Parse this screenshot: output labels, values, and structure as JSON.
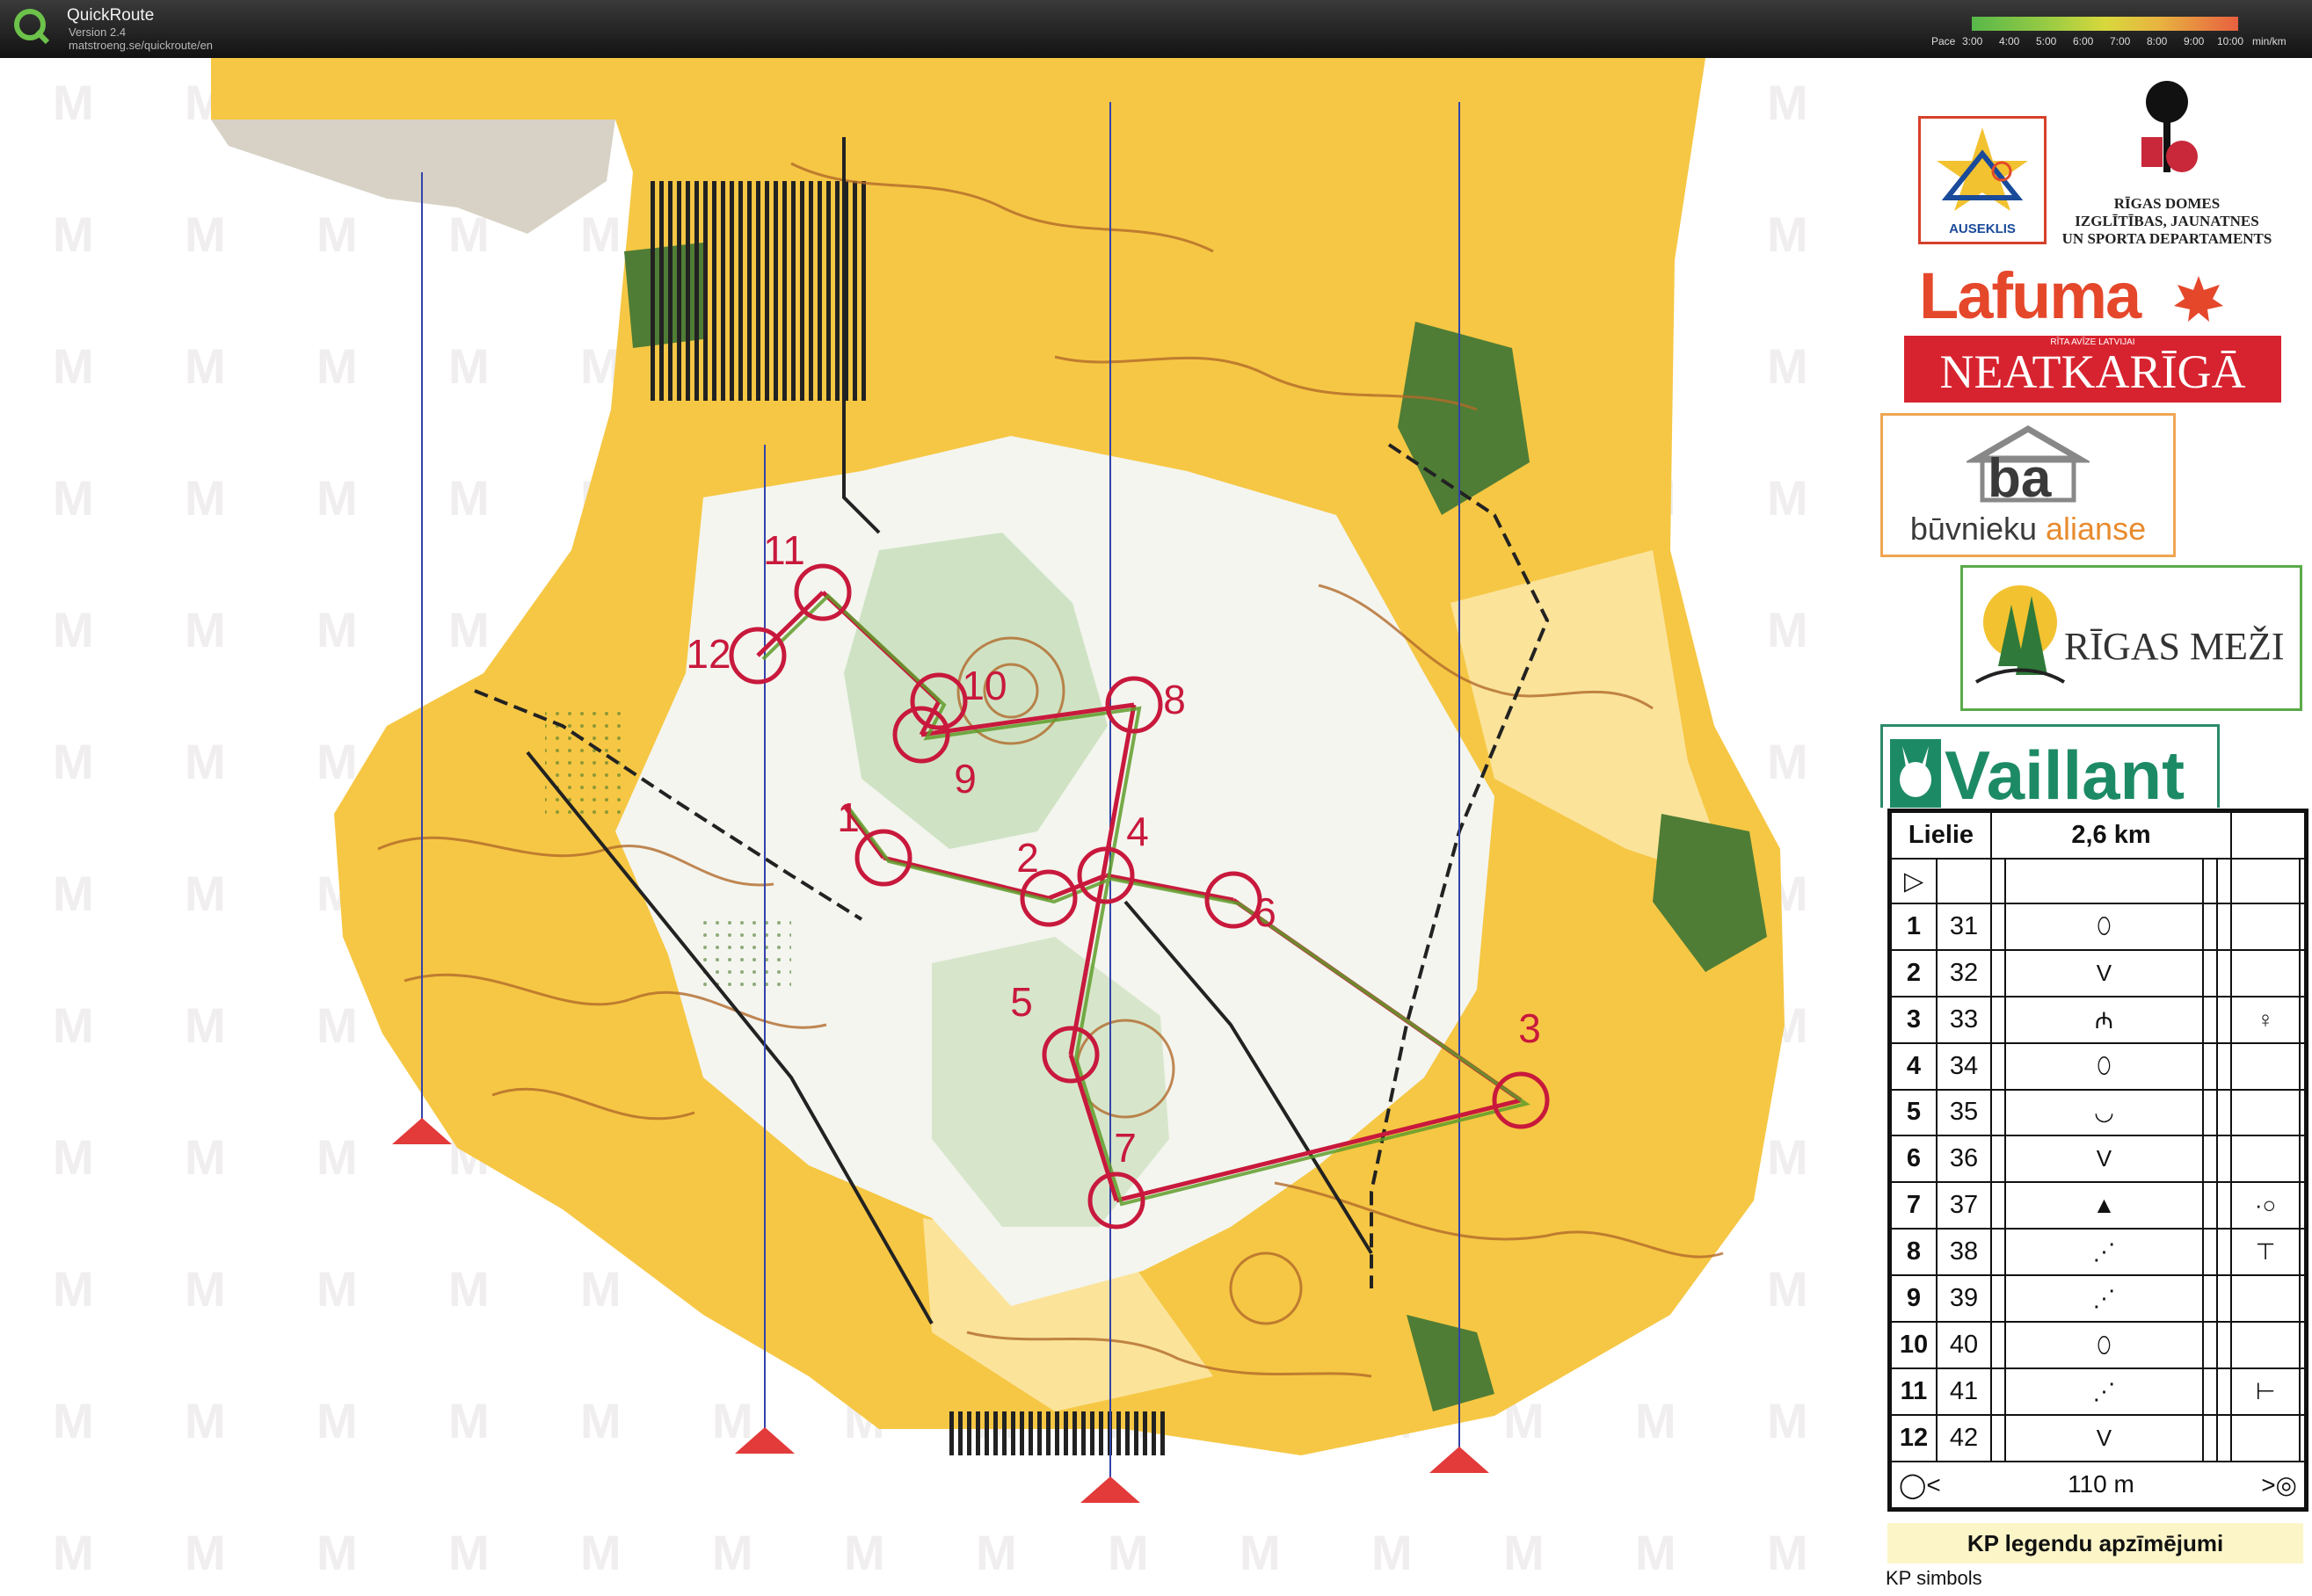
{
  "app": {
    "name": "QuickRoute",
    "version": "Version 2.4",
    "url": "matstroeng.se/quickroute/en"
  },
  "pace_scale": {
    "label": "Pace",
    "ticks": [
      "3:00",
      "4:00",
      "5:00",
      "6:00",
      "7:00",
      "8:00",
      "9:00",
      "10:00"
    ],
    "unit": "min/km"
  },
  "map": {
    "colors": {
      "open": "#f5c542",
      "rough_open": "#fae08c",
      "forest_white": "#ffffff",
      "green": "#5a8a3a",
      "contour": "#b06a2a",
      "course": "#c8193c",
      "settlement": "#d9d3c0",
      "track": "#222222"
    },
    "controls": [
      {
        "label": "1"
      },
      {
        "label": "2"
      },
      {
        "label": "3"
      },
      {
        "label": "4"
      },
      {
        "label": "5"
      },
      {
        "label": "6"
      },
      {
        "label": "7"
      },
      {
        "label": "8"
      },
      {
        "label": "9"
      },
      {
        "label": "10"
      },
      {
        "label": "11"
      },
      {
        "label": "12"
      }
    ]
  },
  "sponsors": {
    "ik_name": "AUSEKLIS",
    "riga_lines": [
      "RĪGAS DOMES",
      "IZGLĪTĪBAS, JAUNATNES",
      "UN SPORTA DEPARTAMENTS"
    ],
    "lafuma": "Lafuma",
    "neat_tag": "RĪTA AVĪZE LATVIJAI",
    "neat": "NEATKARĪGĀ",
    "ba_logo": "ba",
    "ba_text1": "būvnieku",
    "ba_text2": "alianse",
    "rigas_mezi": "RĪGAS MEŽI",
    "vaillant": "Vaillant"
  },
  "description": {
    "course": "Lielie",
    "length": "2,6 km",
    "rows": [
      {
        "n": "1",
        "code": "31",
        "sym": "⬯",
        "extra": ""
      },
      {
        "n": "2",
        "code": "32",
        "sym": "V",
        "extra": ""
      },
      {
        "n": "3",
        "code": "33",
        "sym": "₼",
        "extra": "♀"
      },
      {
        "n": "4",
        "code": "34",
        "sym": "⬯",
        "extra": ""
      },
      {
        "n": "5",
        "code": "35",
        "sym": "◡",
        "extra": ""
      },
      {
        "n": "6",
        "code": "36",
        "sym": "V",
        "extra": ""
      },
      {
        "n": "7",
        "code": "37",
        "sym": "▲",
        "extra": "·○"
      },
      {
        "n": "8",
        "code": "38",
        "sym": "⋰",
        "extra": "⊤"
      },
      {
        "n": "9",
        "code": "39",
        "sym": "⋰",
        "extra": ""
      },
      {
        "n": "10",
        "code": "40",
        "sym": "⬯",
        "extra": ""
      },
      {
        "n": "11",
        "code": "41",
        "sym": "⋰",
        "extra": "⊢"
      },
      {
        "n": "12",
        "code": "42",
        "sym": "V",
        "extra": ""
      }
    ],
    "finish": "110 m"
  },
  "legend": {
    "title": "KP legendu apzīmējumi",
    "subtitle": "KP  simbols"
  }
}
